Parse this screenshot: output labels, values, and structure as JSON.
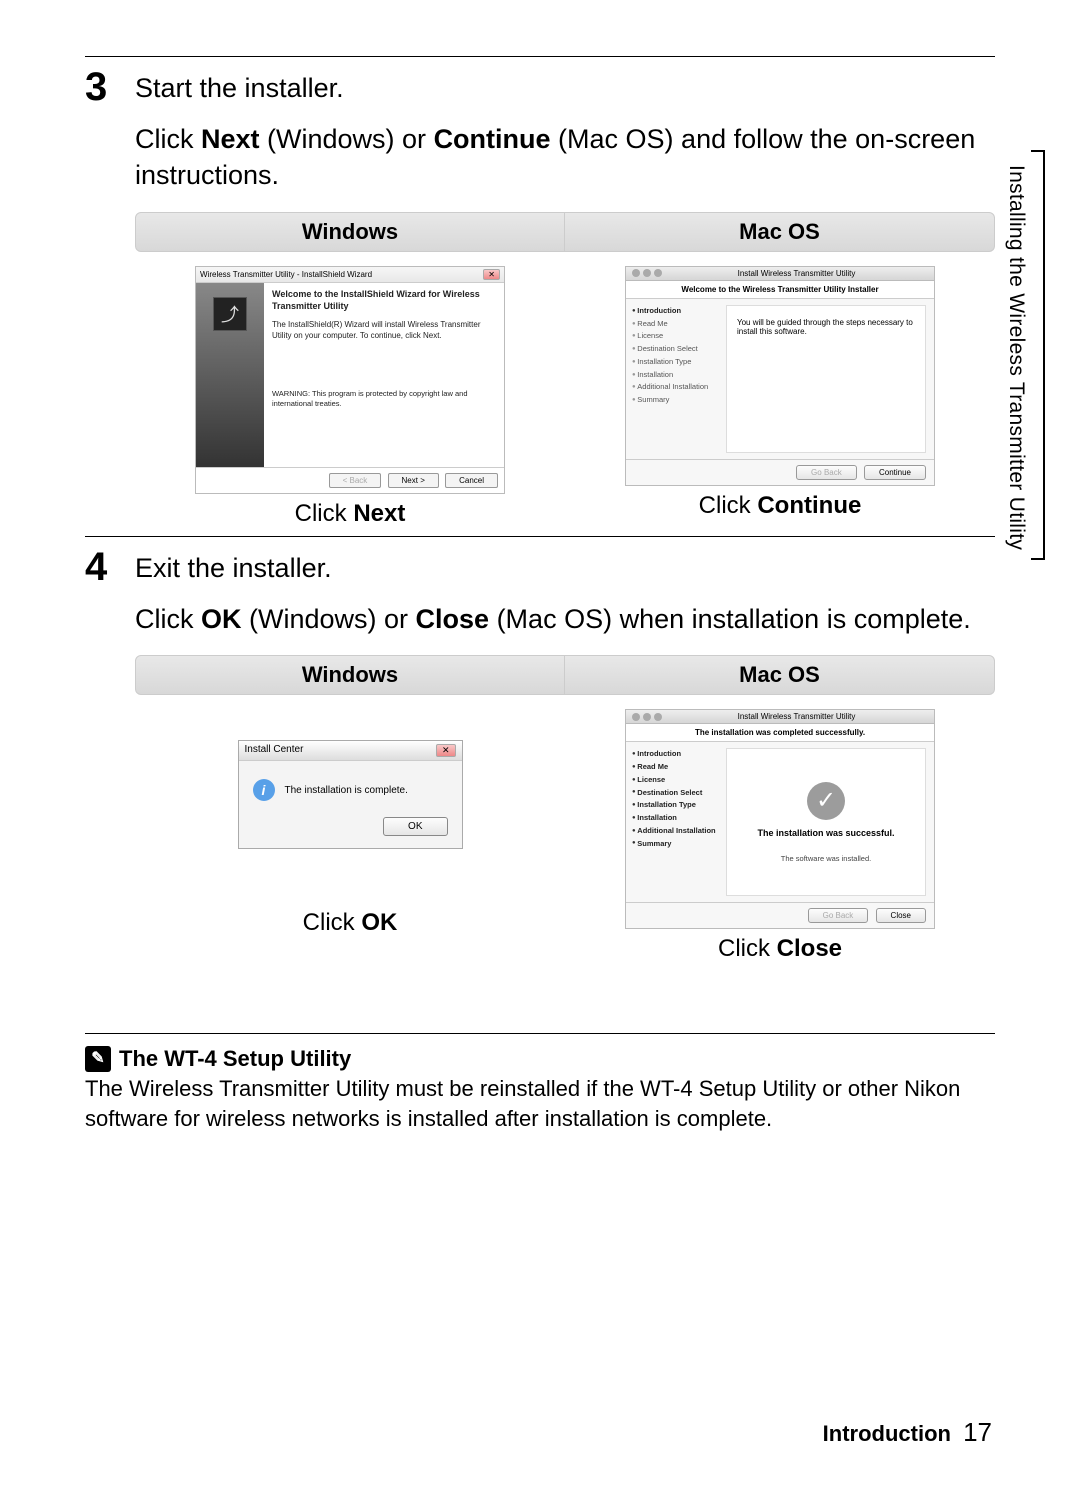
{
  "side_tab": "Installing the Wireless Transmitter Utility",
  "step3": {
    "num": "3",
    "title": "Start the installer.",
    "body_pre": "Click ",
    "body_bold1": "Next",
    "body_mid1": " (Windows) or ",
    "body_bold2": "Continue",
    "body_mid2": " (Mac OS) and follow the on-screen instructions.",
    "headers": {
      "win": "Windows",
      "mac": "Mac OS"
    },
    "caption_win_pre": "Click ",
    "caption_win_b": "Next",
    "caption_mac_pre": "Click ",
    "caption_mac_b": "Continue",
    "win_dialog": {
      "title": "Wireless Transmitter Utility - InstallShield Wizard",
      "heading": "Welcome to the InstallShield Wizard for Wireless Transmitter Utility",
      "text": "The InstallShield(R) Wizard will install Wireless Transmitter Utility on your computer. To continue, click Next.",
      "warning": "WARNING: This program is protected by copyright law and international treaties.",
      "back": "< Back",
      "next": "Next >",
      "cancel": "Cancel"
    },
    "mac_dialog": {
      "title": "Install Wireless Transmitter Utility",
      "banner": "Welcome to the Wireless Transmitter Utility Installer",
      "steps": [
        "Introduction",
        "Read Me",
        "License",
        "Destination Select",
        "Installation Type",
        "Installation",
        "Additional Installation",
        "Summary"
      ],
      "active_index": 0,
      "body": "You will be guided through the steps necessary to install this software.",
      "goback": "Go Back",
      "continue": "Continue"
    }
  },
  "step4": {
    "num": "4",
    "title": "Exit the installer.",
    "body_pre": "Click ",
    "body_bold1": "OK",
    "body_mid1": " (Windows) or ",
    "body_bold2": "Close",
    "body_mid2": " (Mac OS) when installation is complete.",
    "headers": {
      "win": "Windows",
      "mac": "Mac OS"
    },
    "caption_win_pre": "Click ",
    "caption_win_b": "OK",
    "caption_mac_pre": "Click ",
    "caption_mac_b": "Close",
    "win_dialog": {
      "title": "Install Center",
      "text": "The installation is complete.",
      "ok": "OK"
    },
    "mac_dialog": {
      "title": "Install Wireless Transmitter Utility",
      "banner": "The installation was completed successfully.",
      "steps": [
        "Introduction",
        "Read Me",
        "License",
        "Destination Select",
        "Installation Type",
        "Installation",
        "Additional Installation",
        "Summary"
      ],
      "success_title": "The installation was successful.",
      "success_sub": "The software was installed.",
      "goback": "Go Back",
      "close": "Close"
    }
  },
  "note": {
    "title": "The WT-4 Setup Utility",
    "body": "The Wireless Transmitter Utility must be reinstalled if the WT-4 Setup Utility or other Nikon software for wireless networks is installed after installation is complete."
  },
  "footer": {
    "section": "Introduction",
    "page": "17"
  }
}
